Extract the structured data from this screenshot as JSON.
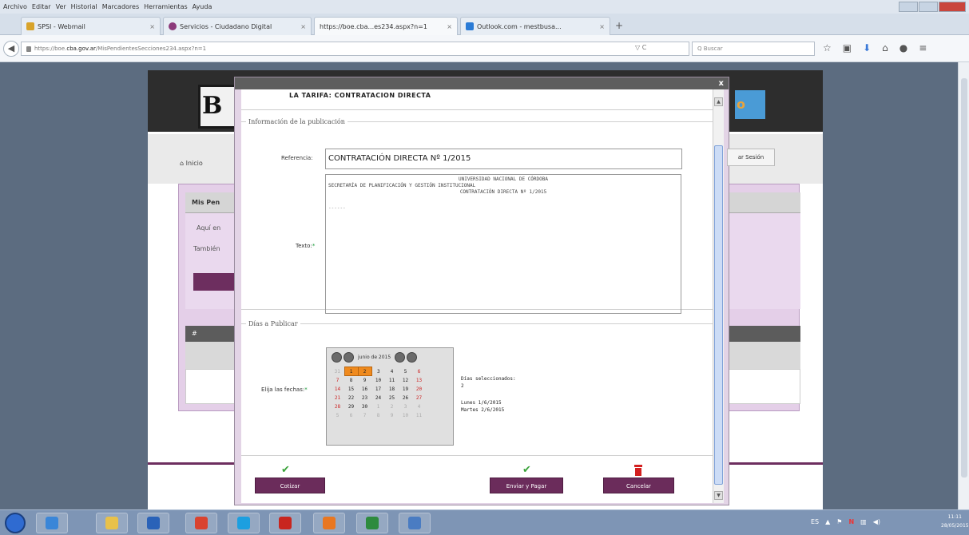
{
  "menu": [
    "Archivo",
    "Editar",
    "Ver",
    "Historial",
    "Marcadores",
    "Herramientas",
    "Ayuda"
  ],
  "tabs": [
    {
      "label": "SPSI - Webmail",
      "color": "#d8a32a"
    },
    {
      "label": "Servicios - Ciudadano Digital",
      "color": "#8c3a7a"
    },
    {
      "label": "https://boe.cba...es234.aspx?n=1",
      "color": "#ffffff"
    },
    {
      "label": "Outlook.com - mestbusa...",
      "color": "#2a7bd6"
    }
  ],
  "newtab_glyph": "+",
  "url": {
    "prefix": "https://boe.",
    "domain": "cba.gov.ar",
    "path": "/MisPendientesSecciones234.aspx?n=1"
  },
  "search_placeholder": "Q Buscar",
  "reload_glyph": "▽ C",
  "page": {
    "logo_letter": "B",
    "logo_right_letter": "o",
    "inicio": "Inicio",
    "cerrar_sesion": "ar Sesión",
    "panel_title": "Mis Pen",
    "panel_text1": "Aquí en",
    "panel_text2": "También",
    "grid_header": "#"
  },
  "modal": {
    "close_glyph": "x",
    "cut_text": "LA TARIFA: CONTRATACION DIRECTA",
    "info_legend": "Información de la publicación",
    "referencia_label": "Referencia:",
    "referencia_value": "CONTRATACIÓN DIRECTA Nº 1/2015",
    "texto_label": "Texto:",
    "texto_lines": [
      "UNIVERSIDAD NACIONAL DE CÓRDOBA",
      "SECRETARÍA DE PLANIFICACIÓN Y GESTIÓN INSTITUCIONAL",
      "CONTRATACIÓN DIRECTA Nº 1/2015"
    ],
    "texto_dots": "------",
    "dias_legend": "Días a Publicar",
    "fechas_label": "Elija las fechas:",
    "calendar_month": "junio de 2015",
    "calendar_rows": [
      [
        "31",
        "1",
        "2",
        "3",
        "4",
        "5",
        "6"
      ],
      [
        "7",
        "8",
        "9",
        "10",
        "11",
        "12",
        "13"
      ],
      [
        "14",
        "15",
        "16",
        "17",
        "18",
        "19",
        "20"
      ],
      [
        "21",
        "22",
        "23",
        "24",
        "25",
        "26",
        "27"
      ],
      [
        "28",
        "29",
        "30",
        "1",
        "2",
        "3",
        "4"
      ],
      [
        "5",
        "6",
        "7",
        "8",
        "9",
        "10",
        "11"
      ]
    ],
    "dias_seleccionados_label": "Días seleccionados:",
    "dias_count": "2",
    "dias_list": [
      "Lunes 1/6/2015",
      "Martes 2/6/2015"
    ],
    "btn_cotizar": "Cotizar",
    "btn_enviar": "Enviar y Pagar",
    "btn_cancelar": "Cancelar",
    "required_mark": "*"
  },
  "taskbar": {
    "icons": [
      {
        "name": "ie",
        "color": "#3a86d8"
      },
      {
        "name": "explorer",
        "color": "#e8c14a"
      },
      {
        "name": "outlook",
        "color": "#2a62b8"
      },
      {
        "name": "chrome",
        "color": "#d9432f"
      },
      {
        "name": "skype",
        "color": "#1c9fe0"
      },
      {
        "name": "acrobat",
        "color": "#c8261f"
      },
      {
        "name": "firefox",
        "color": "#e87722"
      },
      {
        "name": "excel",
        "color": "#2e8b3e"
      },
      {
        "name": "unknown",
        "color": "#4a7cc2"
      }
    ],
    "tray_lang": "ES",
    "clock_time": "11:11",
    "clock_date": "28/05/2015"
  }
}
